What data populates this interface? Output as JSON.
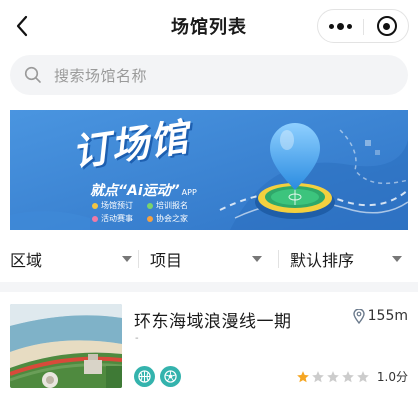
{
  "nav": {
    "title": "场馆列表",
    "back_icon": "chevron-left-icon",
    "more_icon": "more-dots-icon",
    "close_icon": "record-circle-icon"
  },
  "search": {
    "placeholder": "搜索场馆名称",
    "icon": "search-icon"
  },
  "banner": {
    "title": "订场馆",
    "slogan": "就点“Ai运动”",
    "app_tag": "APP",
    "features": [
      {
        "label": "场馆预订",
        "color": "#f4c542"
      },
      {
        "label": "培训报名",
        "color": "#7bd36b"
      },
      {
        "label": "活动赛事",
        "color": "#f07aa5"
      },
      {
        "label": "协会之家",
        "color": "#f4a142"
      }
    ]
  },
  "filters": [
    {
      "label": "区域"
    },
    {
      "label": "项目"
    },
    {
      "label": "默认排序"
    }
  ],
  "venues": [
    {
      "name": "环东海域浪漫线一期",
      "mark": "-",
      "distance": "155m",
      "sports": [
        "basketball-icon",
        "soccer-ball-icon"
      ],
      "rating": 1.0,
      "rating_max": 5,
      "rating_label": "1.0分"
    }
  ],
  "colors": {
    "accent_teal": "#34b3ad",
    "star_active": "#f5a623",
    "star_inactive": "#cccccc",
    "banner_blue": "#3b86d6"
  }
}
